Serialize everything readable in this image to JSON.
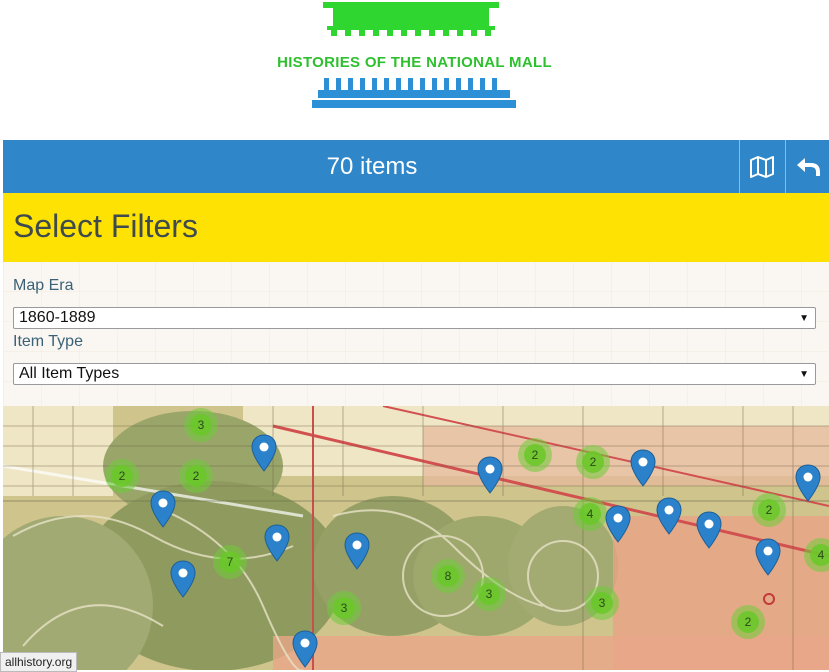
{
  "header": {
    "logo_text": "HISTORIES OF THE NATIONAL MALL",
    "logo_colors": {
      "roof": "#2fd62f",
      "base": "#2d8fd6"
    }
  },
  "items_bar": {
    "count_label": "70 items",
    "map_icon": "map-icon",
    "back_icon": "back-arrow-icon",
    "color": "#2f87c9"
  },
  "filters": {
    "title": "Select Filters",
    "color": "#fee203",
    "map_era": {
      "label": "Map Era",
      "selected": "1860-1889"
    },
    "item_type": {
      "label": "Item Type",
      "selected": "All Item Types"
    }
  },
  "map": {
    "clusters": [
      {
        "count": "3"
      },
      {
        "count": "2"
      },
      {
        "count": "2"
      },
      {
        "count": "7"
      },
      {
        "count": "3"
      },
      {
        "count": "8"
      },
      {
        "count": "3"
      },
      {
        "count": "2"
      },
      {
        "count": "2"
      },
      {
        "count": "4"
      },
      {
        "count": "3"
      },
      {
        "count": "2"
      },
      {
        "count": "2"
      },
      {
        "count": "4"
      }
    ],
    "pin_count": 13
  },
  "status_bar": {
    "url": "allhistory.org"
  }
}
